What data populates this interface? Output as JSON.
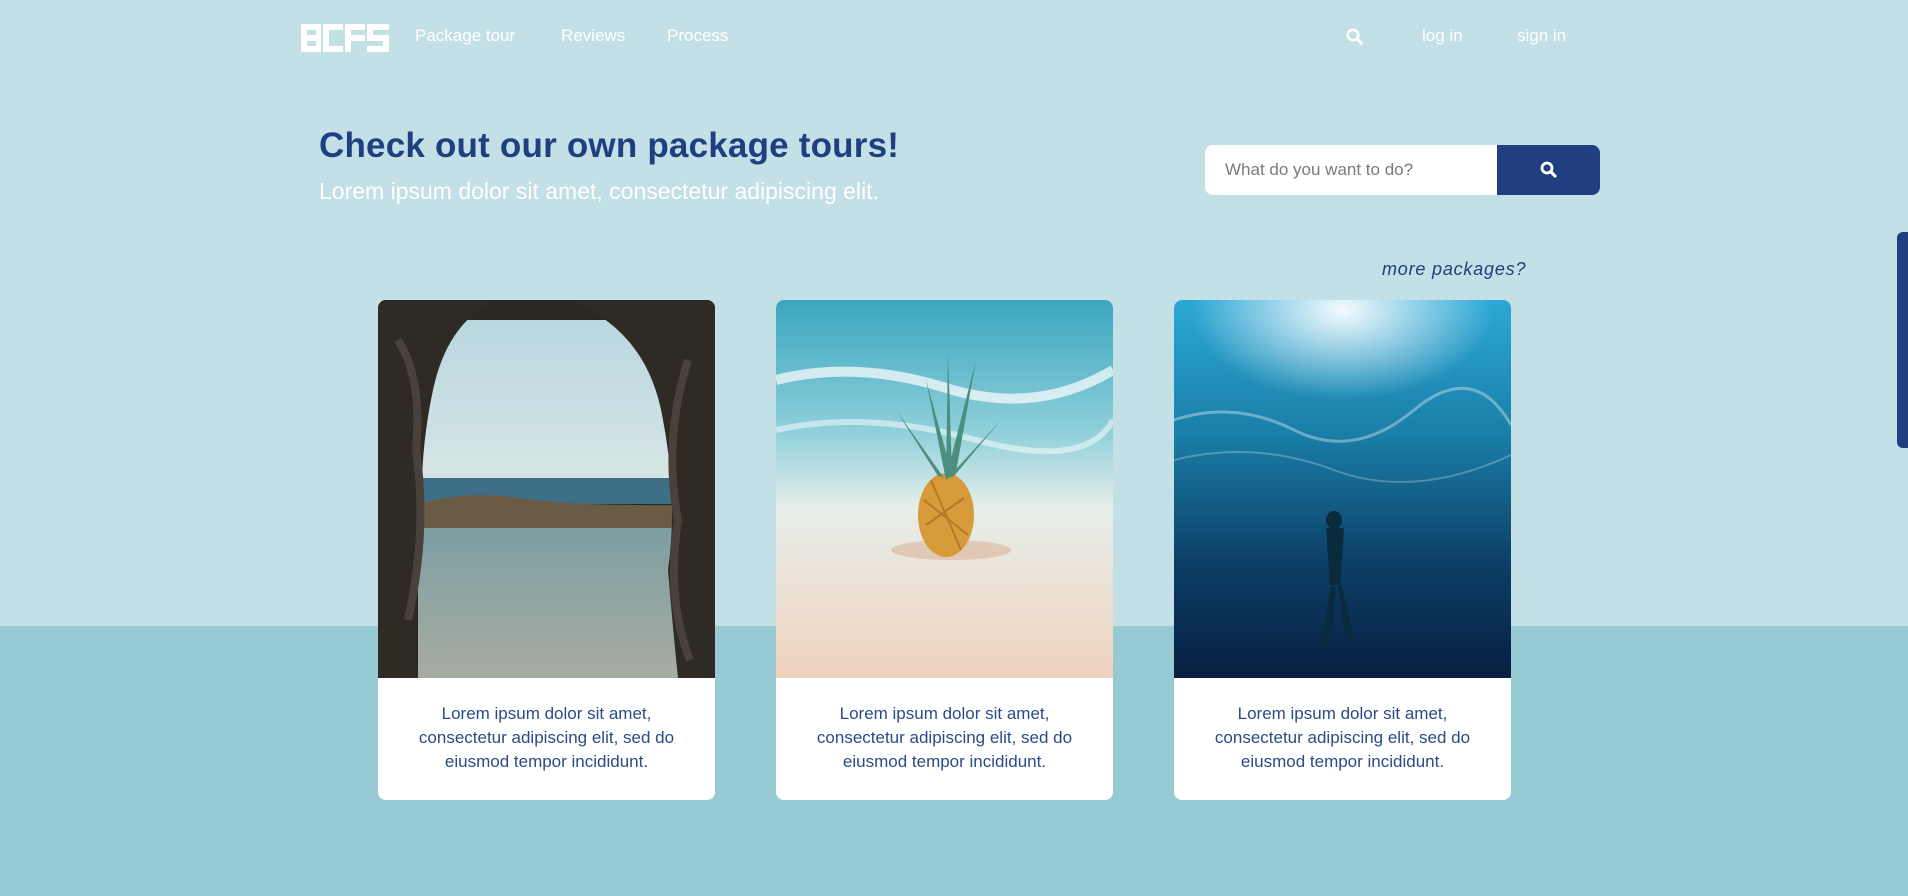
{
  "nav": {
    "logo_text": "BCFS",
    "links": [
      "Package tour",
      "Reviews",
      "Process"
    ],
    "search_icon": "search-icon",
    "login": "log in",
    "signin": "sign in"
  },
  "hero": {
    "title": "Check out our own package tours!",
    "subtitle": "Lorem ipsum dolor sit amet, consectetur adipiscing elit."
  },
  "search": {
    "placeholder": "What do you want to do?",
    "value": "",
    "button_icon": "search-icon"
  },
  "more_link": "more packages?",
  "cards": [
    {
      "image": "sea-through-rock-arch",
      "text": "Lorem ipsum dolor sit amet, consectetur adipiscing elit, sed do eiusmod tempor incididunt."
    },
    {
      "image": "pineapple-on-beach",
      "text": "Lorem ipsum dolor sit amet, consectetur adipiscing elit, sed do eiusmod tempor incididunt."
    },
    {
      "image": "freediver-underwater",
      "text": "Lorem ipsum dolor sit amet, consectetur adipiscing elit, sed do eiusmod tempor incididunt."
    }
  ],
  "colors": {
    "background_top": "#c2e0e5",
    "background_bottom": "#98cad3",
    "accent": "#1f3f80",
    "card_text": "#2c4a86"
  }
}
